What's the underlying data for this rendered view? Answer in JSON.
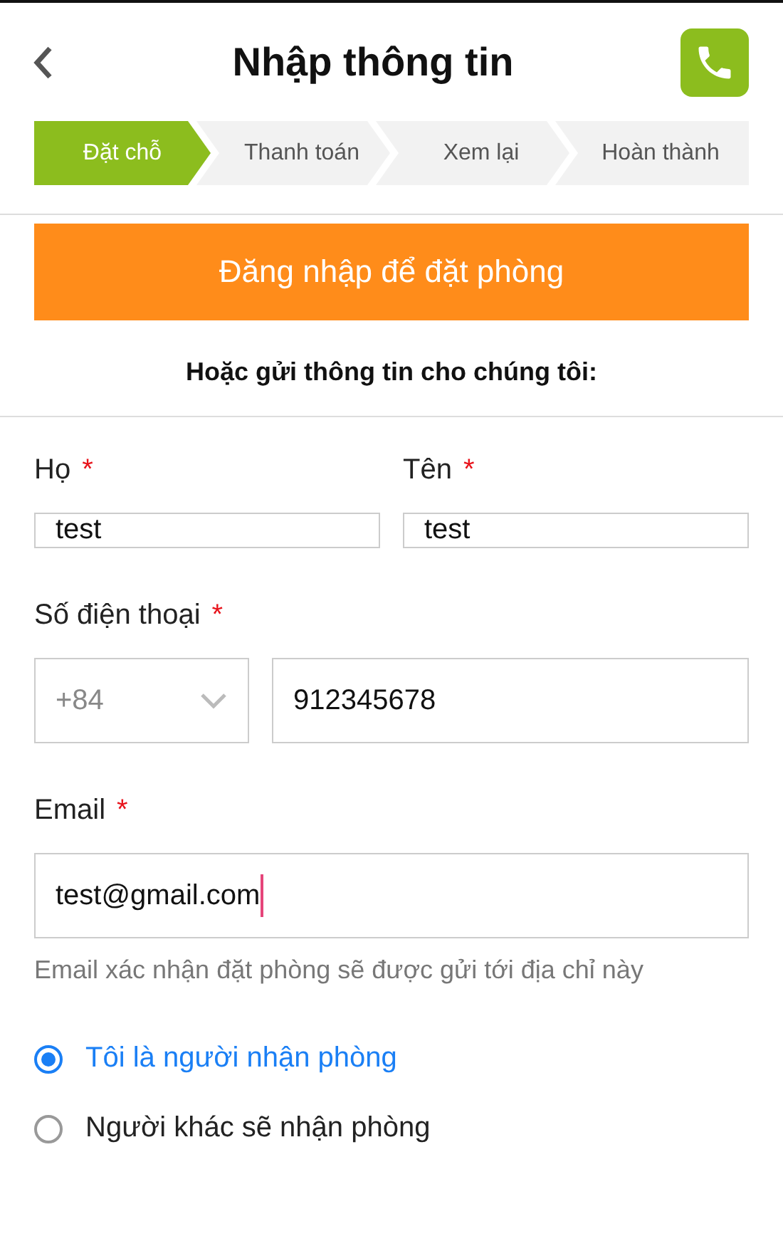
{
  "header": {
    "title": "Nhập thông tin"
  },
  "steps": [
    {
      "label": "Đặt chỗ",
      "selected": true
    },
    {
      "label": "Thanh toán",
      "selected": false
    },
    {
      "label": "Xem lại",
      "selected": false
    },
    {
      "label": "Hoàn thành",
      "selected": false
    }
  ],
  "login_button": "Đăng nhập để đặt phòng",
  "subtitle": "Hoặc gửi thông tin cho chúng tôi:",
  "form": {
    "last_name": {
      "label": "Họ",
      "required_mark": "*",
      "value": "test"
    },
    "first_name": {
      "label": "Tên",
      "required_mark": "*",
      "value": "test"
    },
    "phone": {
      "label": "Số điện thoại",
      "required_mark": "*",
      "country_code": "+84",
      "value": "912345678"
    },
    "email": {
      "label": "Email",
      "required_mark": "*",
      "value": "test@gmail.com",
      "focused": true,
      "hint": "Email xác nhận đặt phòng sẽ được gửi tới địa chỉ này"
    }
  },
  "guest_options": [
    {
      "label": "Tôi là người nhận phòng",
      "selected": true
    },
    {
      "label": "Người khác sẽ nhận phòng",
      "selected": false
    }
  ]
}
